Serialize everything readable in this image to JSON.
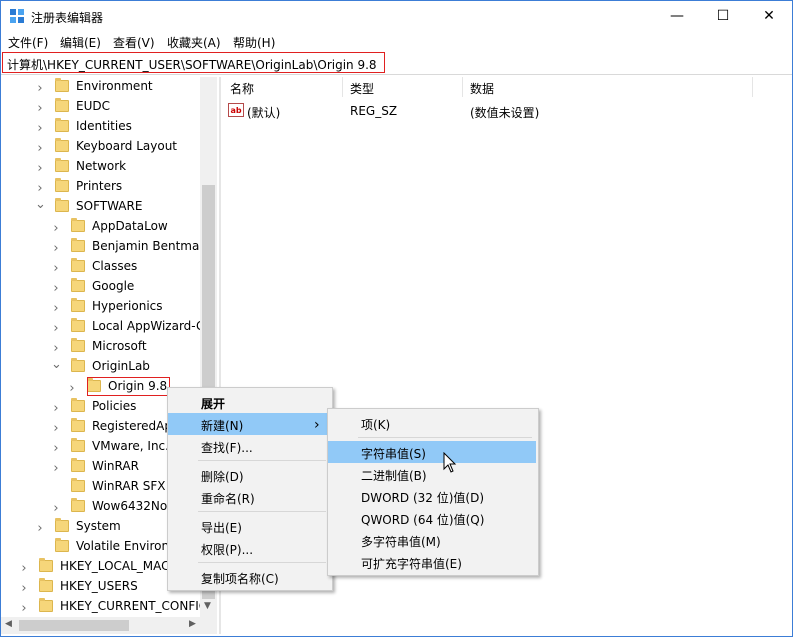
{
  "window": {
    "title": "注册表编辑器",
    "minimize_glyph": "—",
    "maximize_glyph": "☐",
    "close_glyph": "✕",
    "accent": "#3c7dd6"
  },
  "menu": [
    "文件(F)",
    "编辑(E)",
    "查看(V)",
    "收藏夹(A)",
    "帮助(H)"
  ],
  "address": {
    "path": "计算机\\HKEY_CURRENT_USER\\SOFTWARE\\OriginLab\\Origin 9.8"
  },
  "tree": [
    {
      "label": "Environment",
      "level": 2,
      "chev": "right"
    },
    {
      "label": "EUDC",
      "level": 2,
      "chev": "right"
    },
    {
      "label": "Identities",
      "level": 2,
      "chev": "right"
    },
    {
      "label": "Keyboard Layout",
      "level": 2,
      "chev": "right"
    },
    {
      "label": "Network",
      "level": 2,
      "chev": "right"
    },
    {
      "label": "Printers",
      "level": 2,
      "chev": "right"
    },
    {
      "label": "SOFTWARE",
      "level": 2,
      "chev": "down"
    },
    {
      "label": "AppDataLow",
      "level": 3,
      "chev": "right"
    },
    {
      "label": "Benjamin Bentman",
      "level": 3,
      "chev": "right"
    },
    {
      "label": "Classes",
      "level": 3,
      "chev": "right"
    },
    {
      "label": "Google",
      "level": 3,
      "chev": "right"
    },
    {
      "label": "Hyperionics",
      "level": 3,
      "chev": "right"
    },
    {
      "label": "Local AppWizard-G",
      "level": 3,
      "chev": "right"
    },
    {
      "label": "Microsoft",
      "level": 3,
      "chev": "right"
    },
    {
      "label": "OriginLab",
      "level": 3,
      "chev": "down"
    },
    {
      "label": "Origin 9.8",
      "level": 4,
      "chev": "right",
      "selected": true
    },
    {
      "label": "Policies",
      "level": 3,
      "chev": "right"
    },
    {
      "label": "RegisteredAp",
      "level": 3,
      "chev": "right"
    },
    {
      "label": "VMware, Inc.",
      "level": 3,
      "chev": "right"
    },
    {
      "label": "WinRAR",
      "level": 3,
      "chev": "right"
    },
    {
      "label": "WinRAR SFX",
      "level": 3,
      "chev": "none"
    },
    {
      "label": "Wow6432No",
      "level": 3,
      "chev": "right"
    },
    {
      "label": "System",
      "level": 2,
      "chev": "right"
    },
    {
      "label": "Volatile Environ",
      "level": 2,
      "chev": "none"
    },
    {
      "label": "HKEY_LOCAL_MAC",
      "level": 1,
      "chev": "right"
    },
    {
      "label": "HKEY_USERS",
      "level": 1,
      "chev": "right"
    },
    {
      "label": "HKEY_CURRENT_CONFIG",
      "level": 1,
      "chev": "right"
    }
  ],
  "list": {
    "headers": [
      "名称",
      "类型",
      "数据"
    ],
    "rows": [
      {
        "icon": "ab",
        "name": "(默认)",
        "type": "REG_SZ",
        "data": "(数值未设置)"
      }
    ]
  },
  "context_menu": {
    "items": [
      {
        "label": "展开",
        "bold": true
      },
      {
        "label": "新建(N)",
        "submenu": true,
        "highlighted": true
      },
      {
        "label": "查找(F)..."
      },
      {
        "sep": true
      },
      {
        "label": "删除(D)"
      },
      {
        "label": "重命名(R)"
      },
      {
        "sep": true
      },
      {
        "label": "导出(E)"
      },
      {
        "label": "权限(P)..."
      },
      {
        "sep": true
      },
      {
        "label": "复制项名称(C)"
      }
    ]
  },
  "submenu": {
    "items": [
      {
        "label": "项(K)"
      },
      {
        "sep": true
      },
      {
        "label": "字符串值(S)",
        "highlighted": true
      },
      {
        "label": "二进制值(B)"
      },
      {
        "label": "DWORD (32 位)值(D)"
      },
      {
        "label": "QWORD (64 位)值(Q)"
      },
      {
        "label": "多字符串值(M)"
      },
      {
        "label": "可扩充字符串值(E)"
      }
    ]
  }
}
